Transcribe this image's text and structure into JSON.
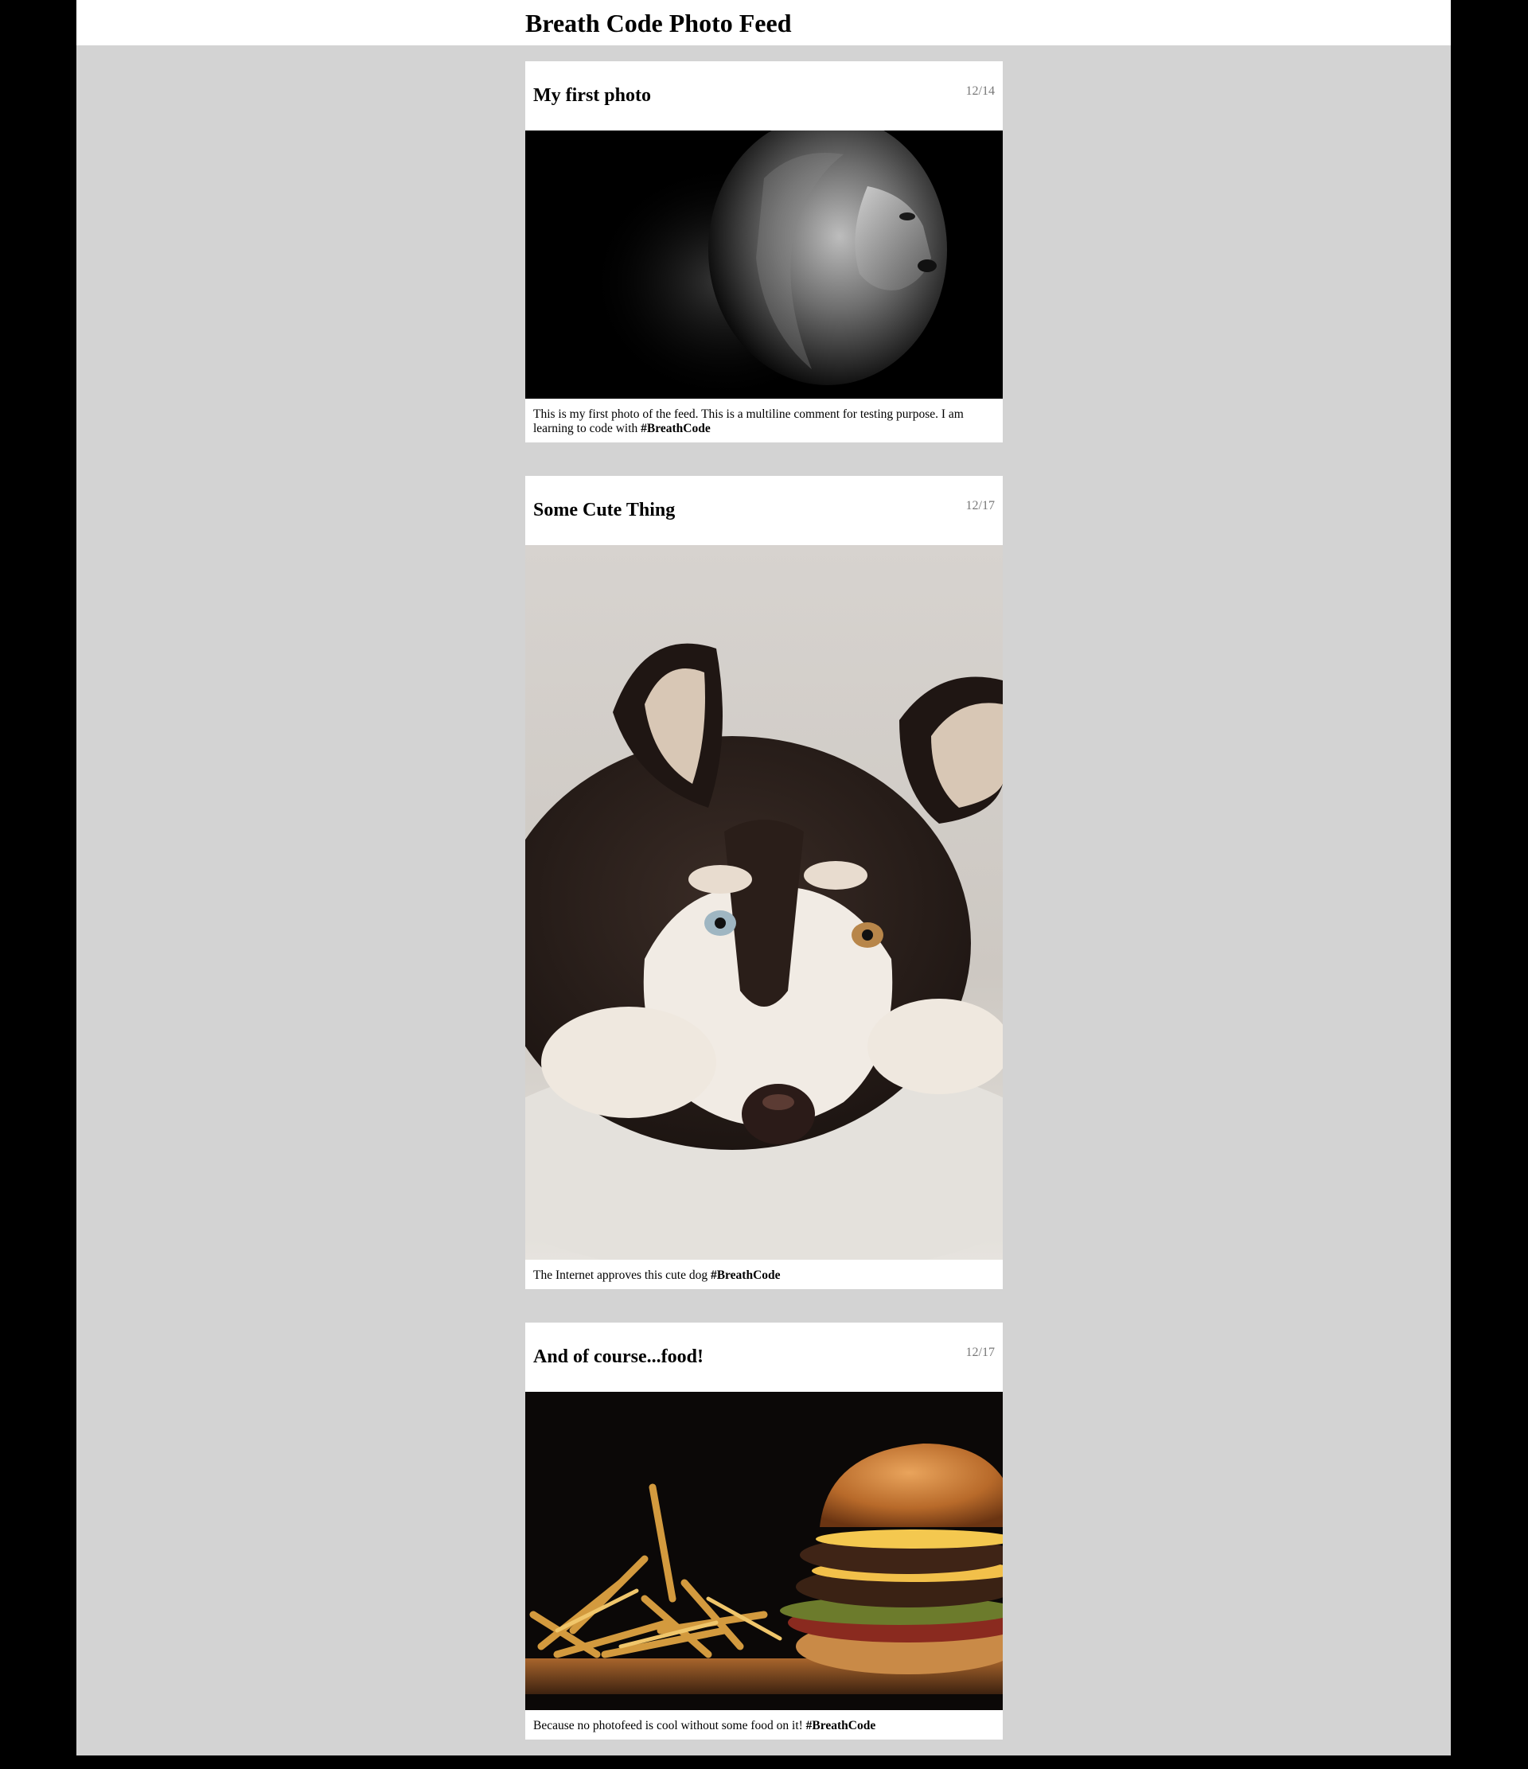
{
  "header": {
    "title": "Breath Code Photo Feed"
  },
  "posts": [
    {
      "title": "My first photo",
      "date": "12/14",
      "photo": "lion-portrait",
      "caption": "This is my first photo of the feed. This is a multiline comment for testing purpose. I am learning to code with ",
      "hashtag": "#BreathCode"
    },
    {
      "title": "Some Cute Thing",
      "date": "12/17",
      "photo": "husky-puppy",
      "caption": "The Internet approves this cute dog ",
      "hashtag": "#BreathCode"
    },
    {
      "title": "And of course...food!",
      "date": "12/17",
      "photo": "burger-and-fries",
      "caption": "Because no photofeed is cool without some food on it! ",
      "hashtag": "#BreathCode"
    }
  ]
}
